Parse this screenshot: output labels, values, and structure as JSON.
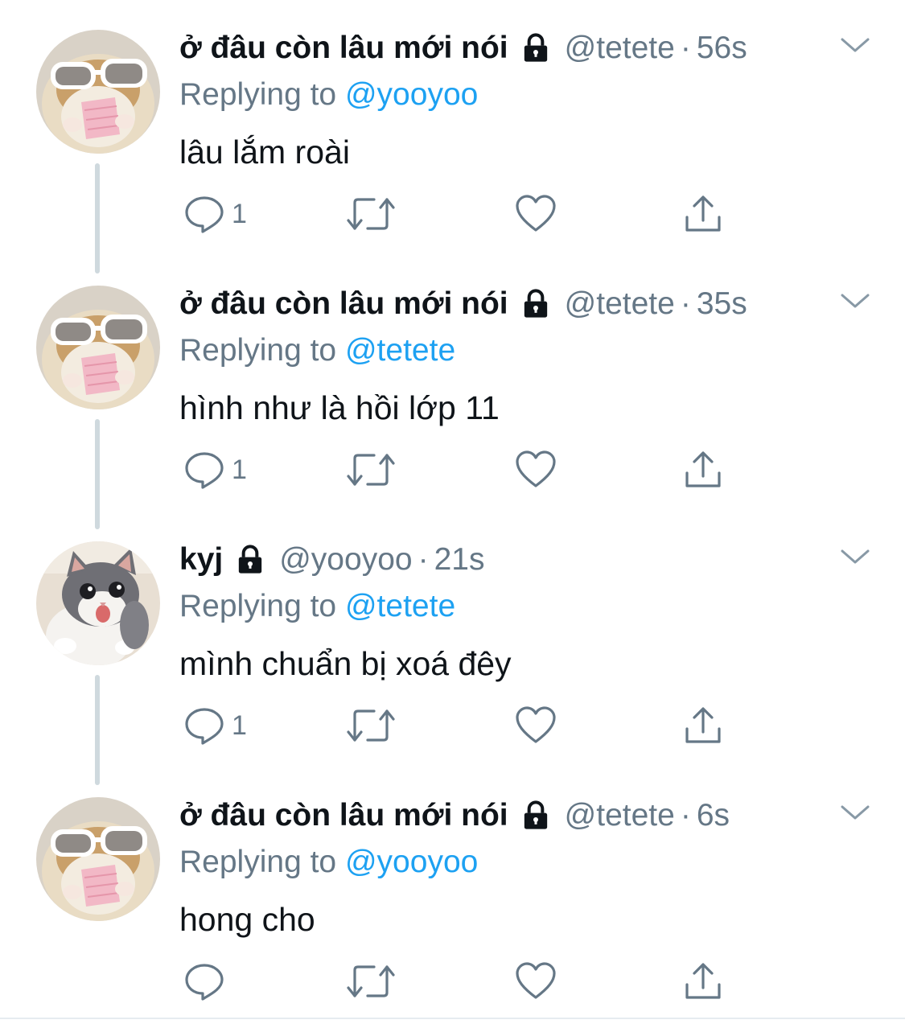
{
  "colors": {
    "accent": "#1da1f2",
    "muted": "#657786",
    "text": "#0f1419",
    "thread": "#cfd9de"
  },
  "tweets": [
    {
      "display_name": "ở đâu còn lâu mới nói",
      "handle": "@tetete",
      "time": "56s",
      "replying_prefix": "Replying to",
      "replying_to": "@yooyoo",
      "text": "lâu lắm roài",
      "reply_count": "1",
      "avatar": "hamster-avatar"
    },
    {
      "display_name": "ở đâu còn lâu mới nói",
      "handle": "@tetete",
      "time": "35s",
      "replying_prefix": "Replying to",
      "replying_to": "@tetete",
      "text": "hình như là hồi lớp 11",
      "reply_count": "1",
      "avatar": "hamster-avatar"
    },
    {
      "display_name": "kyj",
      "handle": "@yooyoo",
      "time": "21s",
      "replying_prefix": "Replying to",
      "replying_to": "@tetete",
      "text": "mình chuẩn bị xoá đêy",
      "reply_count": "1",
      "avatar": "cat-avatar"
    },
    {
      "display_name": "ở đâu còn lâu mới nói",
      "handle": "@tetete",
      "time": "6s",
      "replying_prefix": "Replying to",
      "replying_to": "@yooyoo",
      "text": "hong cho",
      "reply_count": "",
      "avatar": "hamster-avatar"
    }
  ],
  "separator": "·"
}
